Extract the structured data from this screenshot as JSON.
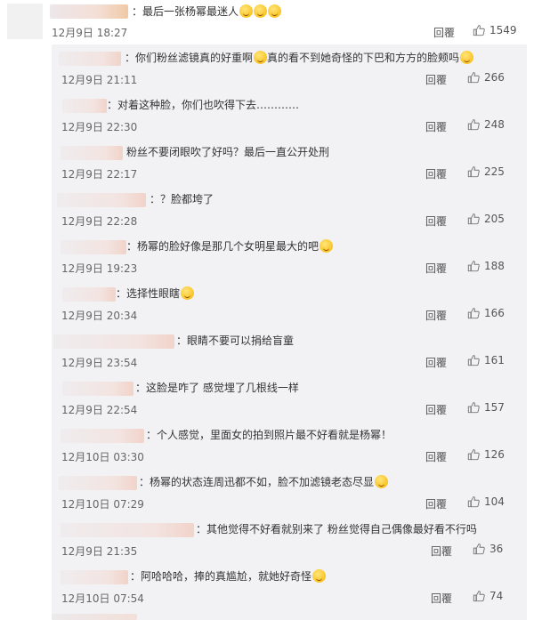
{
  "main_comment": {
    "text": "：最后一张杨幂最迷人",
    "time": "12月9日 18:27",
    "reply_label": "回覆",
    "likes": "1549"
  },
  "sub_comments": [
    {
      "text": "：你们粉丝滤镜真的好重啊",
      "text2": "真的看不到她奇怪的下巴和方方的脸颊吗",
      "time": "12月9日 21:11",
      "reply_label": "回覆",
      "likes": "266"
    },
    {
      "text": "：对着这种脸，你们也吹得下去…………",
      "time": "12月9日 22:30",
      "reply_label": "回覆",
      "likes": "248"
    },
    {
      "text": "粉丝不要闭眼吹了好吗？最后一直公开处刑",
      "time": "12月9日 22:17",
      "reply_label": "回覆",
      "likes": "225"
    },
    {
      "text": "：？脸都垮了",
      "time": "12月9日 22:28",
      "reply_label": "回覆",
      "likes": "205"
    },
    {
      "text": "：杨幂的脸好像是那几个女明星最大的吧",
      "time": "12月9日 19:23",
      "reply_label": "回覆",
      "likes": "188"
    },
    {
      "text": "：选择性眼瞎",
      "time": "12月9日 20:34",
      "reply_label": "回覆",
      "likes": "166"
    },
    {
      "text": "：眼睛不要可以捐给盲童",
      "time": "12月9日 23:54",
      "reply_label": "回覆",
      "likes": "161"
    },
    {
      "text": "：这脸是咋了 感觉埋了几根线一样",
      "time": "12月9日 22:54",
      "reply_label": "回覆",
      "likes": "157"
    },
    {
      "text": "：个人感觉，里面女的拍到照片最不好看就是杨幂！",
      "time": "12月10日 03:30",
      "reply_label": "回覆",
      "likes": "126"
    },
    {
      "text": "：杨幂的状态连周迅都不如，脸不加滤镜老态尽显",
      "time": "12月10日 07:29",
      "reply_label": "回覆",
      "likes": "104"
    },
    {
      "text": "：其他觉得不好看就别来了 粉丝觉得自己偶像最好看不行吗",
      "time": "12月9日 21:35",
      "reply_label": "回覆",
      "likes": "36"
    },
    {
      "text": "：阿哈哈哈，捧的真尴尬，就她好奇怪",
      "time": "12月10日 07:54",
      "reply_label": "回覆",
      "likes": "74"
    }
  ]
}
